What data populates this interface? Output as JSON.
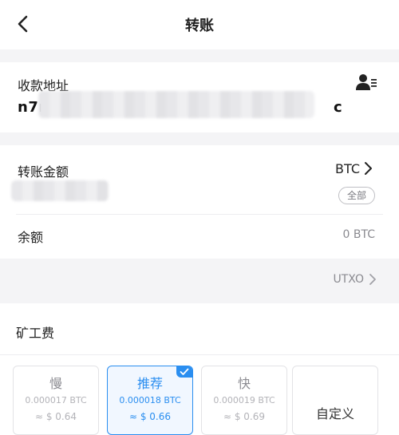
{
  "header": {
    "title": "转账",
    "back_icon": "chevron-left-icon"
  },
  "address": {
    "label": "收款地址",
    "value_start": "n7na",
    "value_end": "c",
    "contact_icon": "contact-book-icon"
  },
  "amount": {
    "label": "转账金额",
    "unit": "BTC",
    "all_label": "全部",
    "balance_label": "余额",
    "balance_value": "0 BTC"
  },
  "utxo": {
    "label": "UTXO"
  },
  "fee": {
    "label": "矿工费",
    "options": [
      {
        "name": "慢",
        "btc": "0.000017 BTC",
        "usd": "≈ $ 0.64",
        "selected": false
      },
      {
        "name": "推荐",
        "btc": "0.000018 BTC",
        "usd": "≈ $ 0.66",
        "selected": true
      },
      {
        "name": "快",
        "btc": "0.000019 BTC",
        "usd": "≈ $ 0.69",
        "selected": false
      }
    ],
    "custom_label": "自定义"
  },
  "colors": {
    "accent": "#2a8ef0",
    "background": "#f4f4f6"
  }
}
